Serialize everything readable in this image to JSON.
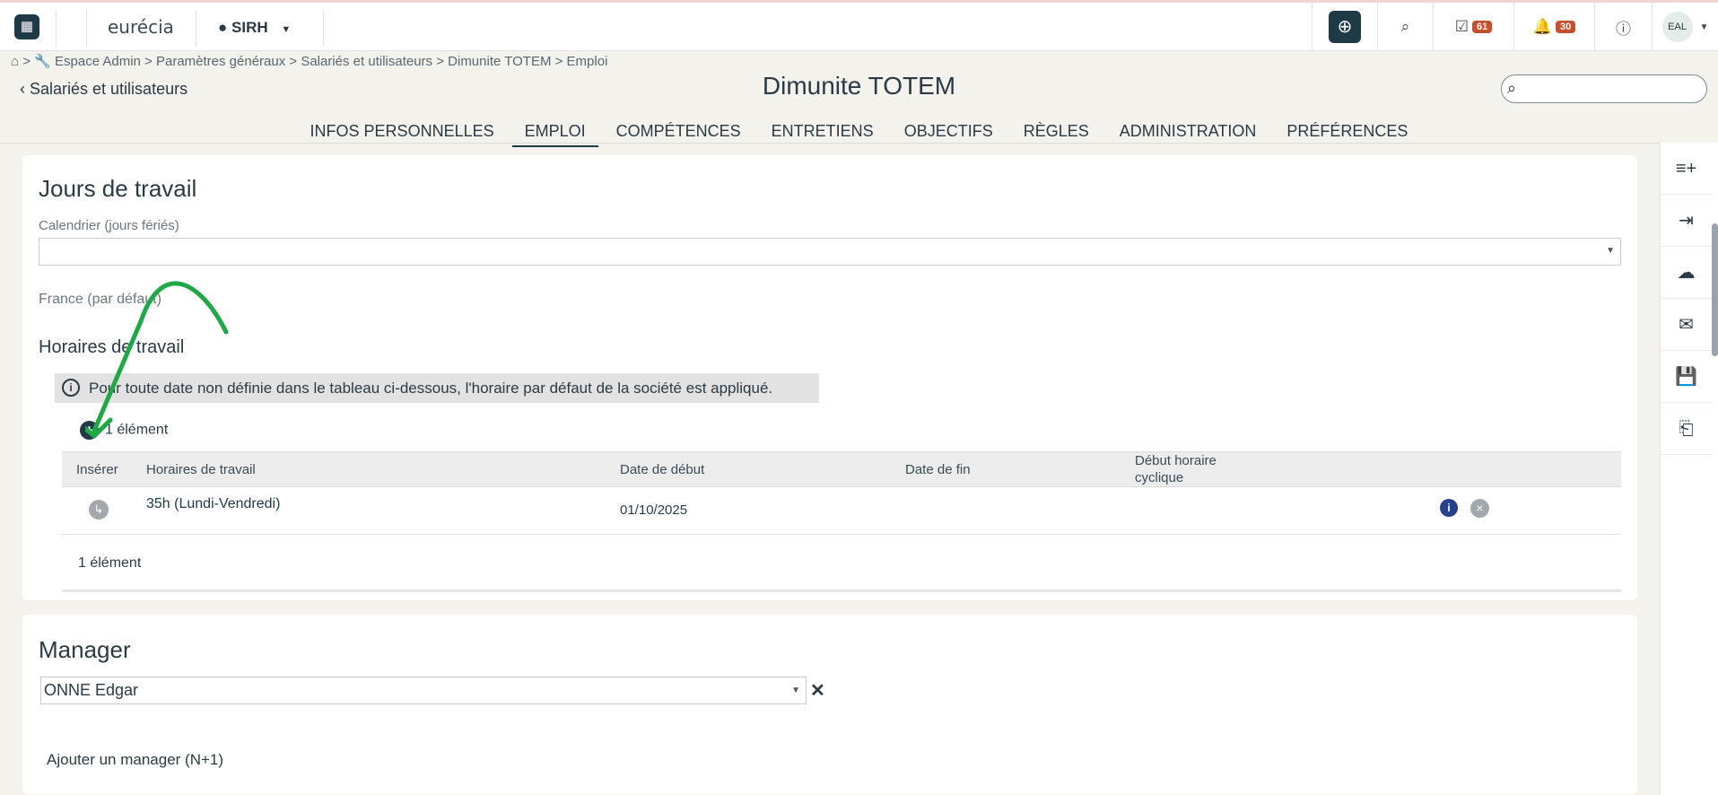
{
  "topbar": {
    "logo": "eurécia",
    "module": "SIRH",
    "tasks_badge": "61",
    "notifications_badge": "30",
    "avatar_initials": "EAL"
  },
  "breadcrumb": "⌂ >  🔧 Espace Admin > Paramètres généraux > Salariés et utilisateurs > Dimunite TOTEM > Emploi",
  "header": {
    "back_label": "Salariés et utilisateurs",
    "title": "Dimunite TOTEM",
    "search_placeholder": ""
  },
  "tabs": [
    {
      "label": "INFOS PERSONNELLES"
    },
    {
      "label": "EMPLOI"
    },
    {
      "label": "COMPÉTENCES"
    },
    {
      "label": "ENTRETIENS"
    },
    {
      "label": "OBJECTIFS"
    },
    {
      "label": "RÈGLES"
    },
    {
      "label": "ADMINISTRATION"
    },
    {
      "label": "PRÉFÉRENCES"
    }
  ],
  "work_days": {
    "title": "Jours de travail",
    "calendar_label": "Calendrier (jours fériés)",
    "calendar_value": "",
    "default_hint": "France (par défaut)",
    "schedules_title": "Horaires de travail",
    "info_text": "Pour toute date non définie dans le tableau ci-dessous, l'horaire par défaut de la société est appliqué.",
    "count_top": "1 élément",
    "count_bottom": "1 élément",
    "columns": {
      "insert": "Insérer",
      "schedule": "Horaires de travail",
      "start": "Date de début",
      "end": "Date de fin",
      "cyclic_1": "Début horaire",
      "cyclic_2": "cyclique"
    },
    "rows": [
      {
        "schedule": "35h (Lundi-Vendredi)",
        "start": "01/10/2025",
        "end": "",
        "cyclic": ""
      }
    ]
  },
  "manager": {
    "title": "Manager",
    "value": "ONNE Edgar",
    "add_label": "Ajouter un manager (N+1)"
  },
  "annotation_color": "#1fa845"
}
